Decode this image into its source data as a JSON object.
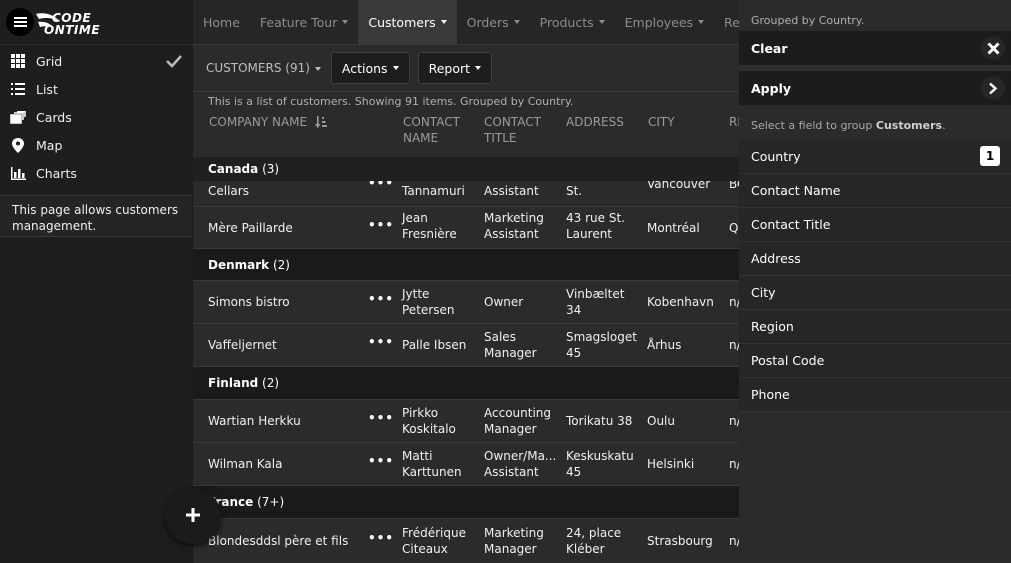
{
  "brand": {
    "line1": "CODE",
    "line2": "ONTIME"
  },
  "views": [
    {
      "label": "Grid",
      "icon": "grid-icon",
      "selected": true
    },
    {
      "label": "List",
      "icon": "list-icon",
      "selected": false
    },
    {
      "label": "Cards",
      "icon": "cards-icon",
      "selected": false
    },
    {
      "label": "Map",
      "icon": "map-marker-icon",
      "selected": false
    },
    {
      "label": "Charts",
      "icon": "bar-chart-icon",
      "selected": false
    }
  ],
  "page_description": "This page allows customers management.",
  "nav": [
    "Home",
    "Feature Tour",
    "Customers",
    "Orders",
    "Products",
    "Employees",
    "Reports"
  ],
  "nav_active": "Customers",
  "toolbar": {
    "view_selector": "CUSTOMERS (91)",
    "actions": "Actions",
    "report": "Report"
  },
  "info": "This is a list of customers. Showing 91 items. Grouped by Country.",
  "columns": [
    {
      "line1": "COMPANY NAME",
      "line2": ""
    },
    {
      "line1": "CONTACT",
      "line2": "NAME"
    },
    {
      "line1": "CONTACT",
      "line2": "TITLE"
    },
    {
      "line1": "ADDRESS",
      "line2": ""
    },
    {
      "line1": "CITY",
      "line2": ""
    },
    {
      "line1": "RE",
      "line2": ""
    }
  ],
  "sticky_group": {
    "name": "Canada",
    "count": "(3)"
  },
  "partial_row": {
    "company": "Cellars",
    "contact": "Tannamuri",
    "title": "Assistant",
    "address": "St.",
    "city": "Vancouver",
    "region": "BC"
  },
  "groups": [
    {
      "name": "Canada",
      "count": "(3)",
      "rows": [
        {
          "company": "Mère Paillarde",
          "contact": [
            "Jean",
            "Fresnière"
          ],
          "title": [
            "Marketing",
            "Assistant"
          ],
          "address": [
            "43 rue St.",
            "Laurent"
          ],
          "city": "Montréal",
          "region": "Q"
        }
      ]
    },
    {
      "name": "Denmark",
      "count": "(2)",
      "rows": [
        {
          "company": "Simons bistro",
          "contact": [
            "Jytte",
            "Petersen"
          ],
          "title": [
            "Owner"
          ],
          "address": [
            "Vinbæltet",
            "34"
          ],
          "city": "Kobenhavn",
          "region": "n/"
        },
        {
          "company": "Vaffeljernet",
          "contact": [
            "Palle Ibsen"
          ],
          "title": [
            "Sales",
            "Manager"
          ],
          "address": [
            "Smagsloget",
            "45"
          ],
          "city": "Århus",
          "region": "n/"
        }
      ]
    },
    {
      "name": "Finland",
      "count": "(2)",
      "rows": [
        {
          "company": "Wartian Herkku",
          "contact": [
            "Pirkko",
            "Koskitalo"
          ],
          "title": [
            "Accounting",
            "Manager"
          ],
          "address": [
            "Torikatu 38"
          ],
          "city": "Oulu",
          "region": "n/"
        },
        {
          "company": "Wilman Kala",
          "contact": [
            "Matti",
            "Karttunen"
          ],
          "title": [
            "Owner/Ma...",
            "Assistant"
          ],
          "address": [
            "Keskuskatu",
            "45"
          ],
          "city": "Helsinki",
          "region": "n/"
        }
      ]
    },
    {
      "name": "France",
      "count": "(7+)",
      "rows": [
        {
          "company": "Blondesddsl père et fils",
          "contact": [
            "Frédérique",
            "Citeaux"
          ],
          "title": [
            "Marketing",
            "Manager"
          ],
          "address": [
            "24, place",
            "Kléber"
          ],
          "city": "Strasbourg",
          "region": "n/"
        }
      ]
    }
  ],
  "more_label": "•••",
  "panel": {
    "header": "Grouped by Country.",
    "clear": "Clear",
    "apply": "Apply",
    "hint_prefix": "Select a field to group ",
    "hint_entity": "Customers",
    "hint_suffix": ".",
    "fields": [
      {
        "label": "Country",
        "badge": "1"
      },
      {
        "label": "Contact Name",
        "badge": ""
      },
      {
        "label": "Contact Title",
        "badge": ""
      },
      {
        "label": "Address",
        "badge": ""
      },
      {
        "label": "City",
        "badge": ""
      },
      {
        "label": "Region",
        "badge": ""
      },
      {
        "label": "Postal Code",
        "badge": ""
      },
      {
        "label": "Phone",
        "badge": ""
      }
    ]
  }
}
